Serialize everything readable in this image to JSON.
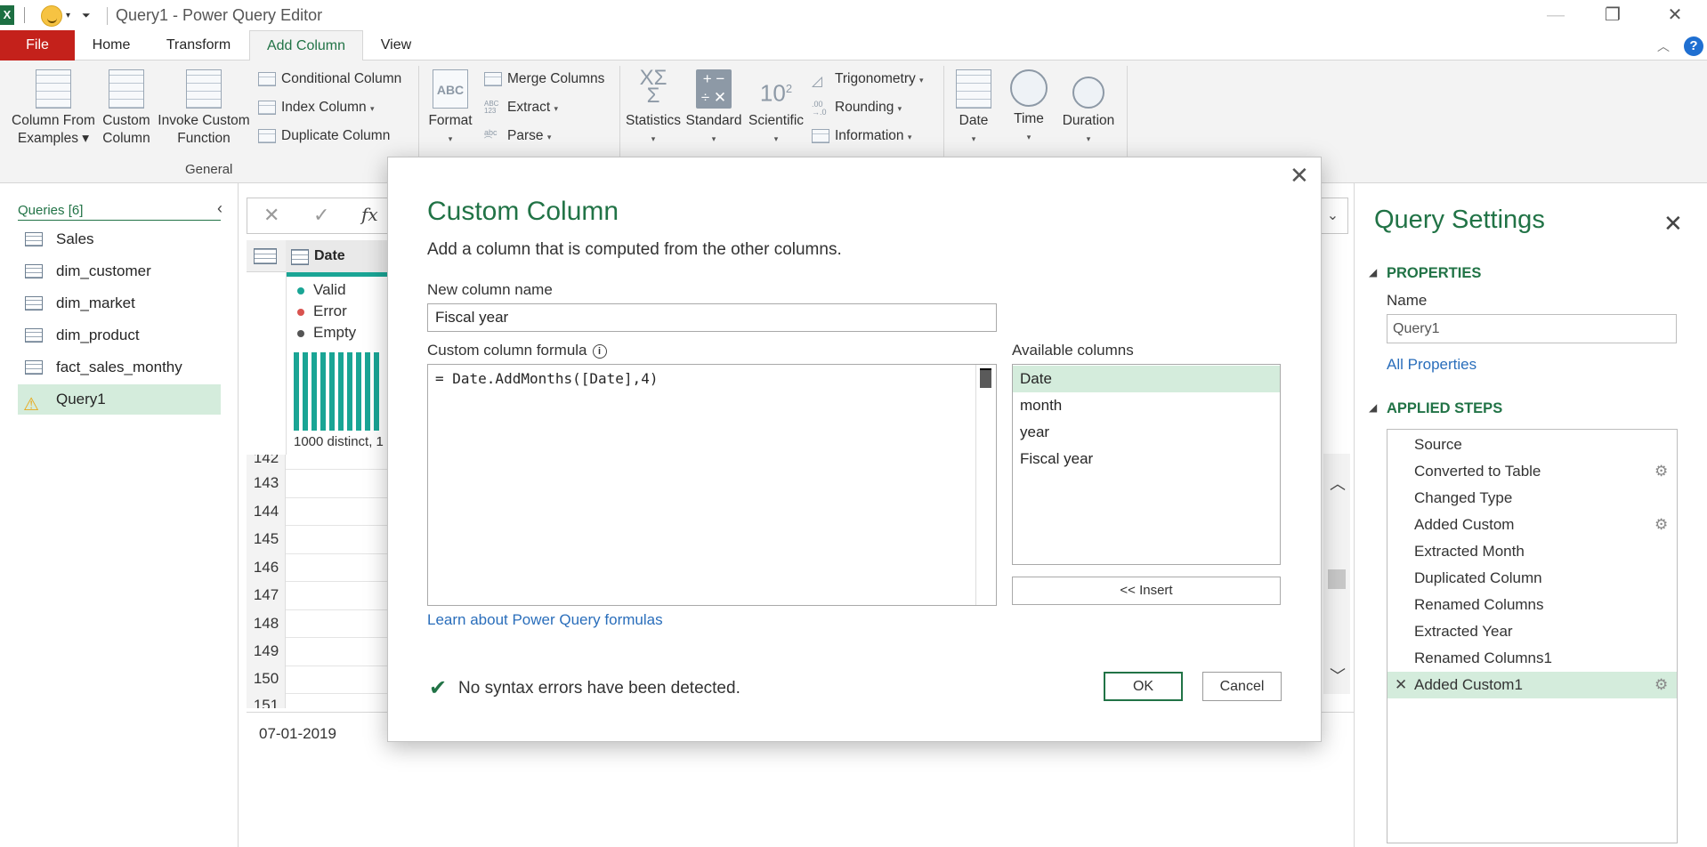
{
  "window": {
    "title": "Query1 - Power Query Editor",
    "excel_badge": "X",
    "minimize": "—",
    "restore": "❐",
    "close": "✕"
  },
  "tabs": [
    "File",
    "Home",
    "Transform",
    "Add Column",
    "View"
  ],
  "active_tab": "Add Column",
  "ribbon": {
    "general": {
      "column_from_examples": [
        "Column From",
        "Examples ▾"
      ],
      "custom_column": [
        "Custom",
        "Column"
      ],
      "invoke_custom_function": [
        "Invoke Custom",
        "Function"
      ],
      "conditional_column": "Conditional Column",
      "index_column": "Index Column",
      "duplicate_column": "Duplicate Column",
      "group_label": "General"
    },
    "from_text": {
      "format": "Format",
      "merge_columns": "Merge Columns",
      "extract": "Extract",
      "parse": "Parse"
    },
    "from_number": {
      "statistics": "Statistics",
      "standard": "Standard",
      "scientific": "Scientific",
      "trigonometry": "Trigonometry",
      "rounding": "Rounding",
      "information": "Information"
    },
    "from_datetime": {
      "date": "Date",
      "time": "Time",
      "duration": "Duration"
    }
  },
  "queries": {
    "header": "Queries [6]",
    "items": [
      "Sales",
      "dim_customer",
      "dim_market",
      "dim_product",
      "fact_sales_monthy",
      "Query1"
    ],
    "selected": "Query1"
  },
  "grid": {
    "column_header": "Date",
    "quality": {
      "valid": "Valid",
      "error": "Error",
      "empty": "Empty"
    },
    "distinct_text": "1000 distinct, 1",
    "row_numbers": [
      "142",
      "143",
      "144",
      "145",
      "146",
      "147",
      "148",
      "149",
      "150",
      "151"
    ],
    "preview_value": "07-01-2019"
  },
  "settings": {
    "title": "Query Settings",
    "properties_header": "PROPERTIES",
    "name_label": "Name",
    "name_value": "Query1",
    "all_properties": "All Properties",
    "steps_header": "APPLIED STEPS",
    "steps": [
      {
        "label": "Source",
        "gear": false
      },
      {
        "label": "Converted to Table",
        "gear": true
      },
      {
        "label": "Changed Type",
        "gear": false
      },
      {
        "label": "Added Custom",
        "gear": true
      },
      {
        "label": "Extracted Month",
        "gear": false
      },
      {
        "label": "Duplicated Column",
        "gear": false
      },
      {
        "label": "Renamed Columns",
        "gear": false
      },
      {
        "label": "Extracted Year",
        "gear": false
      },
      {
        "label": "Renamed Columns1",
        "gear": false
      },
      {
        "label": "Added Custom1",
        "gear": true
      }
    ],
    "selected_step": "Added Custom1"
  },
  "dialog": {
    "title": "Custom Column",
    "subtitle": "Add a column that is computed from the other columns.",
    "new_column_label": "New column name",
    "new_column_value": "Fiscal year",
    "formula_label": "Custom column formula",
    "formula_value": "= Date.AddMonths([Date],4)",
    "available_label": "Available columns",
    "available_columns": [
      "Date",
      "month",
      "year",
      "Fiscal year"
    ],
    "selected_column": "Date",
    "insert_button": "<< Insert",
    "learn_link": "Learn about Power Query formulas",
    "status": "No syntax errors have been detected.",
    "ok": "OK",
    "cancel": "Cancel"
  },
  "colors": {
    "accent_green": "#217346",
    "file_red": "#c4211b",
    "selection_green": "#d4ecdc",
    "link_blue": "#2a6ebb",
    "teal_valid": "#1aa595"
  }
}
